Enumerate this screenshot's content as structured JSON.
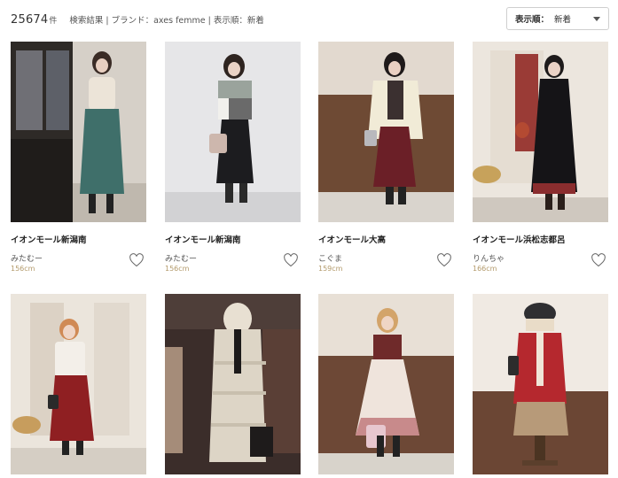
{
  "header": {
    "count": "25674",
    "count_unit": "件",
    "summary": "検索結果 | ブランド：axes femme | 表示順：新着",
    "sort_label": "表示順：",
    "sort_value": "新着"
  },
  "cards": [
    {
      "store": "イオンモール新潟南",
      "staff": "みたむー",
      "height": "156cm",
      "photo": "photo-staff-teal-velvet-skirt"
    },
    {
      "store": "イオンモール新潟南",
      "staff": "みたむー",
      "height": "156cm",
      "photo": "photo-staff-gray-colorblock-sweater"
    },
    {
      "store": "イオンモール大高",
      "staff": "こぐま",
      "height": "159cm",
      "photo": "photo-staff-cream-knit-bordeaux-skirt"
    },
    {
      "store": "イオンモール浜松志都呂",
      "staff": "りんちゃ",
      "height": "166cm",
      "photo": "photo-staff-black-coat"
    },
    {
      "store": "",
      "staff": "",
      "height": "",
      "photo": "photo-staff-white-cardigan-red-skirt"
    },
    {
      "store": "",
      "staff": "",
      "height": "",
      "photo": "photo-cream-down-coat-display"
    },
    {
      "store": "",
      "staff": "",
      "height": "",
      "photo": "photo-staff-bordeaux-jumperskirt"
    },
    {
      "store": "",
      "staff": "",
      "height": "",
      "photo": "photo-mannequin-red-cardigan-plaid-skirt"
    }
  ],
  "colors": {
    "accent_height": "#b39a6b",
    "text": "#333333"
  }
}
